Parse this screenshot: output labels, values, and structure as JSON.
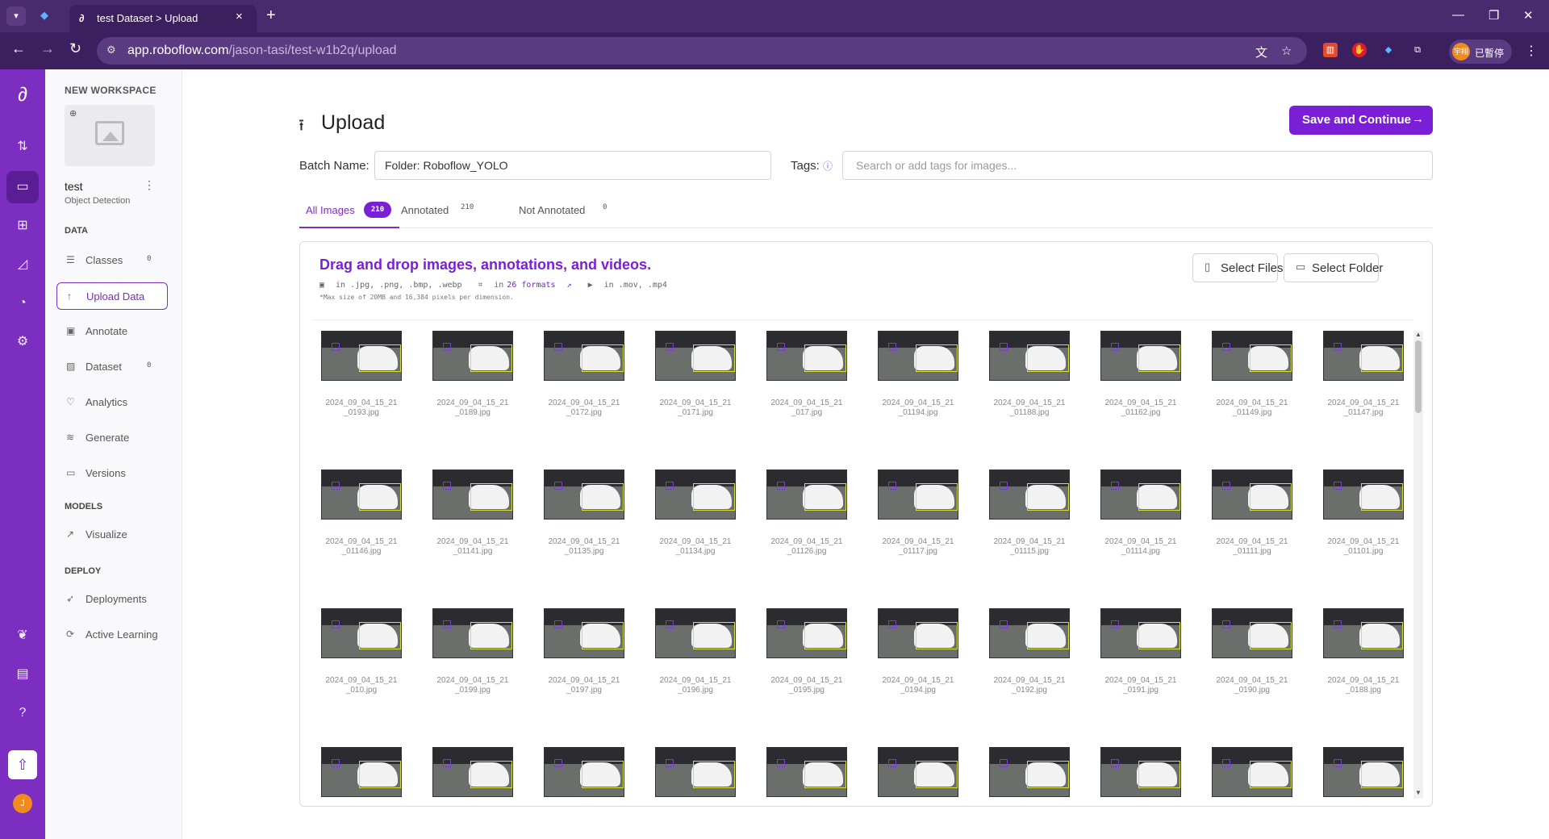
{
  "browser": {
    "tab_title": "test Dataset > Upload",
    "url_host": "app.roboflow.com",
    "url_path": "/jason-tasi/test-w1b2q/upload",
    "profile_label": "已暫停",
    "profile_avatar": "宇翔"
  },
  "sidebar": {
    "workspace_label": "NEW WORKSPACE",
    "project_name": "test",
    "project_type": "Object Detection",
    "data_section": "DATA",
    "models_section": "MODELS",
    "deploy_section": "DEPLOY",
    "items": [
      {
        "label": "Classes",
        "badge": "0",
        "icon": "classes-icon"
      },
      {
        "label": "Upload Data",
        "icon": "upload-icon"
      },
      {
        "label": "Annotate",
        "icon": "annotate-icon"
      },
      {
        "label": "Dataset",
        "badge": "0",
        "icon": "dataset-icon"
      },
      {
        "label": "Analytics",
        "icon": "analytics-icon"
      },
      {
        "label": "Generate",
        "icon": "generate-icon"
      },
      {
        "label": "Versions",
        "icon": "versions-icon"
      },
      {
        "label": "Visualize",
        "icon": "visualize-icon"
      },
      {
        "label": "Deployments",
        "icon": "deployments-icon"
      },
      {
        "label": "Active Learning",
        "icon": "active-learning-icon"
      }
    ]
  },
  "rail": {
    "avatar": "J"
  },
  "header": {
    "title": "Upload",
    "save_label": "Save and Continue"
  },
  "batch": {
    "label": "Batch Name:",
    "value": "Folder: Roboflow_YOLO"
  },
  "tags": {
    "label": "Tags:",
    "placeholder": "Search or add tags for images..."
  },
  "tabs": [
    {
      "label": "All Images",
      "count": "210"
    },
    {
      "label": "Annotated",
      "count": "210"
    },
    {
      "label": "Not Annotated",
      "count": "0"
    }
  ],
  "dropzone": {
    "title": "Drag and drop images, annotations, and videos.",
    "images_formats": "in .jpg, .png, .bmp, .webp",
    "annotation_prefix": "in",
    "annotation_link": "26 formats",
    "video_formats": "in .mov, .mp4",
    "limit": "*Max size of 20MB and 16,384 pixels per dimension.",
    "select_files": "Select Files",
    "select_folder": "Select Folder"
  },
  "files": [
    [
      "2024_09_04_15_21\n_0193.jpg",
      "2024_09_04_15_21\n_0189.jpg",
      "2024_09_04_15_21\n_0172.jpg",
      "2024_09_04_15_21\n_0171.jpg",
      "2024_09_04_15_21\n_017.jpg",
      "2024_09_04_15_21\n_01194.jpg",
      "2024_09_04_15_21\n_01188.jpg",
      "2024_09_04_15_21\n_01162.jpg",
      "2024_09_04_15_21\n_01149.jpg",
      "2024_09_04_15_21\n_01147.jpg"
    ],
    [
      "2024_09_04_15_21\n_01146.jpg",
      "2024_09_04_15_21\n_01141.jpg",
      "2024_09_04_15_21\n_01135.jpg",
      "2024_09_04_15_21\n_01134.jpg",
      "2024_09_04_15_21\n_01126.jpg",
      "2024_09_04_15_21\n_01117.jpg",
      "2024_09_04_15_21\n_01115.jpg",
      "2024_09_04_15_21\n_01114.jpg",
      "2024_09_04_15_21\n_01111.jpg",
      "2024_09_04_15_21\n_01101.jpg"
    ],
    [
      "2024_09_04_15_21\n_010.jpg",
      "2024_09_04_15_21\n_0199.jpg",
      "2024_09_04_15_21\n_0197.jpg",
      "2024_09_04_15_21\n_0196.jpg",
      "2024_09_04_15_21\n_0195.jpg",
      "2024_09_04_15_21\n_0194.jpg",
      "2024_09_04_15_21\n_0192.jpg",
      "2024_09_04_15_21\n_0191.jpg",
      "2024_09_04_15_21\n_0190.jpg",
      "2024_09_04_15_21\n_0188.jpg"
    ]
  ],
  "colors": {
    "brand": "#7b2ebf",
    "accent": "#7b1fd6",
    "annotation_box": "#d8e23a"
  }
}
